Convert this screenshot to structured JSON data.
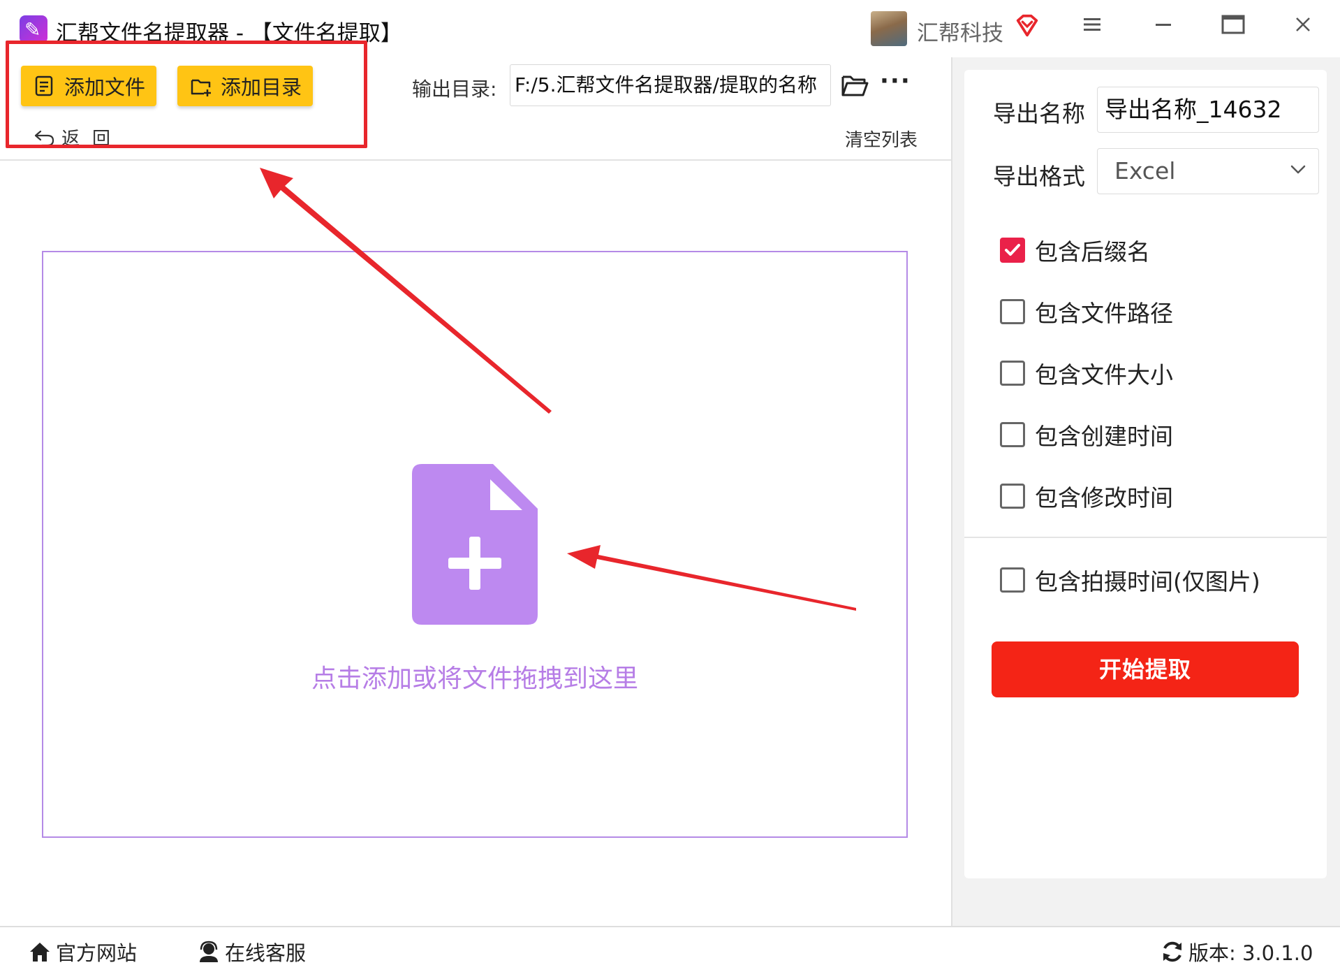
{
  "titlebar": {
    "title": "汇帮文件名提取器 - 【文件名提取】",
    "company": "汇帮科技",
    "menu_icon": "hamburger-menu-icon",
    "minimize_icon": "minimize-icon",
    "maximize_icon": "maximize-icon",
    "close_icon": "close-icon"
  },
  "toolbar": {
    "add_file_label": "添加文件",
    "add_dir_label": "添加目录",
    "back_label": "返回",
    "output_label": "输出目录:",
    "output_path": "F:/5.汇帮文件名提取器/提取的名称",
    "clear_list_label": "清空列表"
  },
  "drop_zone": {
    "hint": "点击添加或将文件拖拽到这里",
    "icon": "file-add-icon"
  },
  "settings": {
    "export_name_label": "导出名称",
    "export_name_value": "导出名称_14632",
    "export_format_label": "导出格式",
    "export_format_value": "Excel",
    "options": [
      {
        "label": "包含后缀名",
        "checked": true
      },
      {
        "label": "包含文件路径",
        "checked": false
      },
      {
        "label": "包含文件大小",
        "checked": false
      },
      {
        "label": "包含创建时间",
        "checked": false
      },
      {
        "label": "包含修改时间",
        "checked": false
      },
      {
        "label": "包含拍摄时间(仅图片)",
        "checked": false
      }
    ],
    "start_button": "开始提取"
  },
  "statusbar": {
    "official_site": "官方网站",
    "online_service": "在线客服",
    "version": "版本: 3.0.1.0"
  },
  "colors": {
    "button_yellow": "#ffc414",
    "accent_red": "#f42416",
    "checkbox_red": "#ea2149",
    "drop_purple": "#b48ae6",
    "annotation_red": "#e8262c"
  }
}
